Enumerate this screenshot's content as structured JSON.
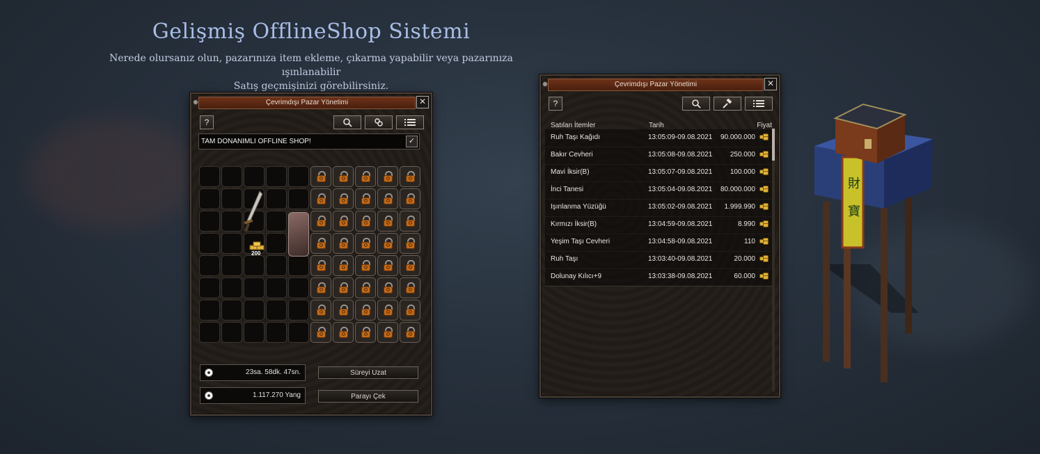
{
  "header": {
    "title": "Gelişmiş OfflineShop Sistemi",
    "subtitle_line1": "Nerede olursanız olun, pazarınıza item ekleme, çıkarma yapabilir veya pazarınıza ışınlanabilir",
    "subtitle_line2": "Satış geçmişinizi görebilirsiniz."
  },
  "shop_window": {
    "title": "Çevrimdışı Pazar Yönetimi",
    "close": "✕",
    "help": "?",
    "shop_name": "TAM DONANIMLI OFFLINE SHOP!",
    "check": "✓",
    "item_stack_count": "200",
    "time_left": "23sa. 58dk. 47sn.",
    "money": "1.117.270 Yang",
    "extend_button": "Süreyi Uzat",
    "withdraw_button": "Parayı Çek"
  },
  "history_window": {
    "title": "Çevrimdışı Pazar Yönetimi",
    "close": "✕",
    "help": "?",
    "columns": [
      "Satılan İtemler",
      "Tarih",
      "Fiyat"
    ],
    "rows": [
      {
        "item": "Ruh Taşı Kağıdı",
        "date": "13:05:09-09.08.2021",
        "price": "90.000.000"
      },
      {
        "item": "Bakır Cevheri",
        "date": "13:05:08-09.08.2021",
        "price": "250.000"
      },
      {
        "item": "Mavi İksir(B)",
        "date": "13:05:07-09.08.2021",
        "price": "100.000"
      },
      {
        "item": "İnci Tanesi",
        "date": "13:05:04-09.08.2021",
        "price": "80.000.000"
      },
      {
        "item": "Işınlanma Yüzüğü",
        "date": "13:05:02-09.08.2021",
        "price": "1.999.990"
      },
      {
        "item": "Kırmızı İksir(B)",
        "date": "13:04:59-09.08.2021",
        "price": "8.990"
      },
      {
        "item": "Yeşim Taşı Cevheri",
        "date": "13:04:58-09.08.2021",
        "price": "110"
      },
      {
        "item": "Ruh Taşı",
        "date": "13:03:40-09.08.2021",
        "price": "20.000"
      },
      {
        "item": "Dolunay Kılıcı+9",
        "date": "13:03:38-09.08.2021",
        "price": "60.000"
      }
    ]
  },
  "icons": {
    "search": "search-icon",
    "settings": "link-icon",
    "hammer": "hammer-icon",
    "list": "list-icon"
  }
}
